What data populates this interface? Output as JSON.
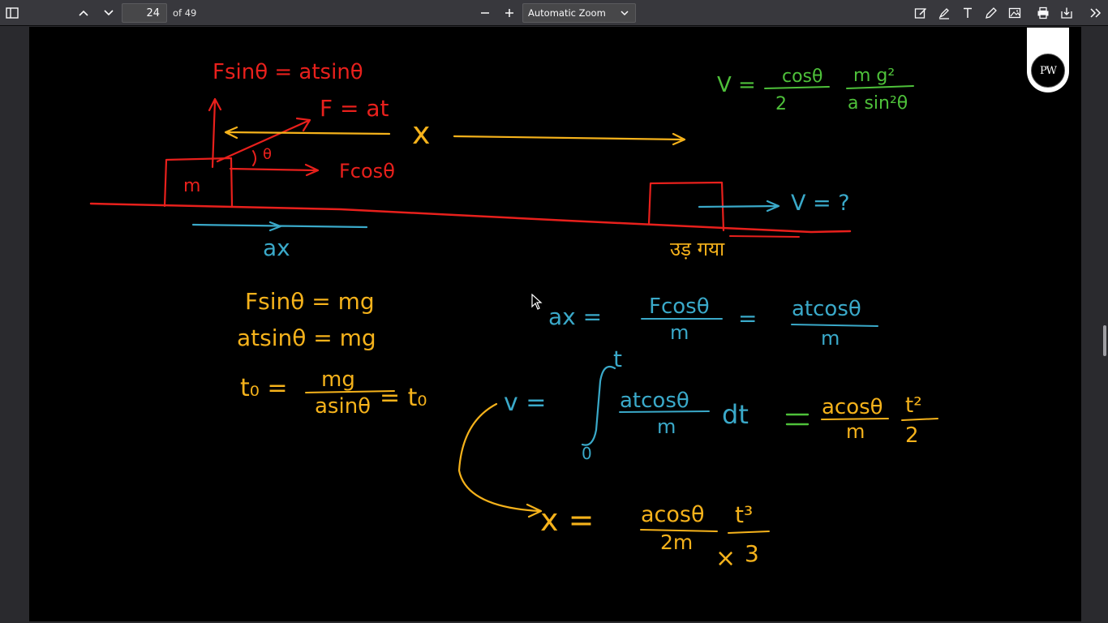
{
  "toolbar": {
    "page_number": "24",
    "page_total": "of 49",
    "zoom_value": "Automatic Zoom",
    "icons": [
      "sidebar-toggle-icon",
      "chevron-up-icon",
      "chevron-down-icon",
      "zoom-out-icon",
      "zoom-in-icon",
      "draw-icon",
      "highlight-icon",
      "text-icon",
      "pencil-icon",
      "image-icon",
      "print-icon",
      "download-icon",
      "tools-menu-icon"
    ]
  },
  "logo": {
    "text": "PW"
  },
  "colors": {
    "red": "#e8201c",
    "orange": "#f5b21b",
    "blue": "#3aa9c9",
    "green": "#4ec13a"
  },
  "notes": {
    "fsin_top": "Fsinθ = atsinθ",
    "force_label": "F = at",
    "theta": "θ",
    "fcos": "Fcosθ",
    "mass": "m",
    "distance": "x",
    "v_question": "V = ?",
    "hindi": "उड़ गया",
    "ax_label": "ax",
    "v_formula": {
      "v": "V =",
      "num1": "cosθ",
      "den1": "2",
      "num2": "m g²",
      "den2": "a sin²θ"
    },
    "eq1": "Fsinθ = mg",
    "eq2": "atsinθ = mg",
    "eq3_left": "t₀ =",
    "eq3_num": "mg",
    "eq3_den": "asinθ",
    "eq3_right": "= t₀",
    "ax_eq": {
      "lhs": "ax =",
      "num1": "Fcosθ",
      "den1": "m",
      "eq": "=",
      "num2": "atcosθ",
      "den2": "m"
    },
    "v_int": {
      "lhs": "v =",
      "upper": "t",
      "lower": "0",
      "num": "atcosθ",
      "den": "m",
      "dt": "dt",
      "eq": "=",
      "num2": "acosθ",
      "den2": "m",
      "num3": "t²",
      "den3": "2"
    },
    "x_eq": {
      "lhs": "x =",
      "num": "acosθ",
      "den": "2m",
      "num2": "t³",
      "den2": "3",
      "times": "×"
    }
  }
}
